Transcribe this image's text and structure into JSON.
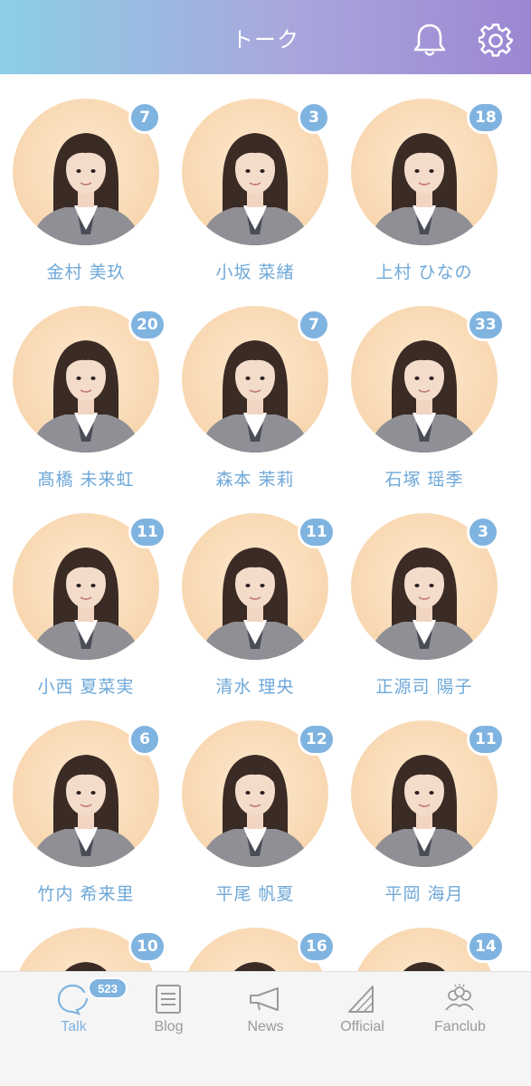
{
  "header": {
    "title": "トーク"
  },
  "members": [
    {
      "name": "金村 美玖",
      "count": "7"
    },
    {
      "name": "小坂 菜緒",
      "count": "3"
    },
    {
      "name": "上村 ひなの",
      "count": "18"
    },
    {
      "name": "髙橋 未来虹",
      "count": "20"
    },
    {
      "name": "森本 茉莉",
      "count": "7"
    },
    {
      "name": "石塚 瑶季",
      "count": "33"
    },
    {
      "name": "小西 夏菜実",
      "count": "11"
    },
    {
      "name": "清水 理央",
      "count": "11"
    },
    {
      "name": "正源司 陽子",
      "count": "3"
    },
    {
      "name": "竹内 希来里",
      "count": "6"
    },
    {
      "name": "平尾 帆夏",
      "count": "12"
    },
    {
      "name": "平岡 海月",
      "count": "11"
    },
    {
      "name": "",
      "count": "10"
    },
    {
      "name": "",
      "count": "16"
    },
    {
      "name": "",
      "count": "14"
    }
  ],
  "tabs": [
    {
      "label": "Talk",
      "icon": "talk-bubble-icon",
      "active": true,
      "badge": "523"
    },
    {
      "label": "Blog",
      "icon": "blog-document-icon",
      "active": false
    },
    {
      "label": "News",
      "icon": "megaphone-icon",
      "active": false
    },
    {
      "label": "Official",
      "icon": "official-logo-icon",
      "active": false
    },
    {
      "label": "Fanclub",
      "icon": "fanclub-group-icon",
      "active": false
    }
  ],
  "colors": {
    "accent": "#7fb3e0",
    "header_start": "#8ccfe6",
    "header_end": "#9d86d2",
    "avatar_bg": "#f8d7b0",
    "tab_inactive": "#9a9a9a"
  }
}
